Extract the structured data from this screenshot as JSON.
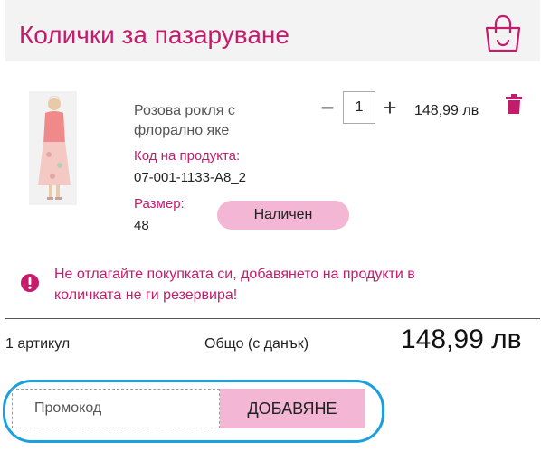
{
  "header": {
    "title": "Колички за пазаруване",
    "bag_icon": "shopping-bag-icon"
  },
  "item": {
    "name": "Розова рокля с флорално яке",
    "code_label": "Код на продукта:",
    "code": "07-001-1133-A8_2",
    "size_label": "Размер:",
    "size": "48",
    "quantity": "1",
    "minus_symbol": "−",
    "plus_symbol": "+",
    "price": "148,99 лв",
    "stock_status": "Наличен",
    "delete_icon": "trash-icon"
  },
  "notice": {
    "icon": "exclamation-circle-icon",
    "text": "Не отлагайте покупката си, добавянето на продукти в количката не ги резервира!"
  },
  "summary": {
    "count": "1 артикул",
    "total_label": "Общо (с данък)",
    "total": "148,99 лв"
  },
  "promo": {
    "placeholder": "Промокод",
    "button_label": "ДОБАВЯНЕ"
  },
  "colors": {
    "accent": "#c41c6b",
    "pink_button": "#f3b6d4",
    "header_bg": "#f3f3f3",
    "highlight": "#1a9fe0"
  }
}
